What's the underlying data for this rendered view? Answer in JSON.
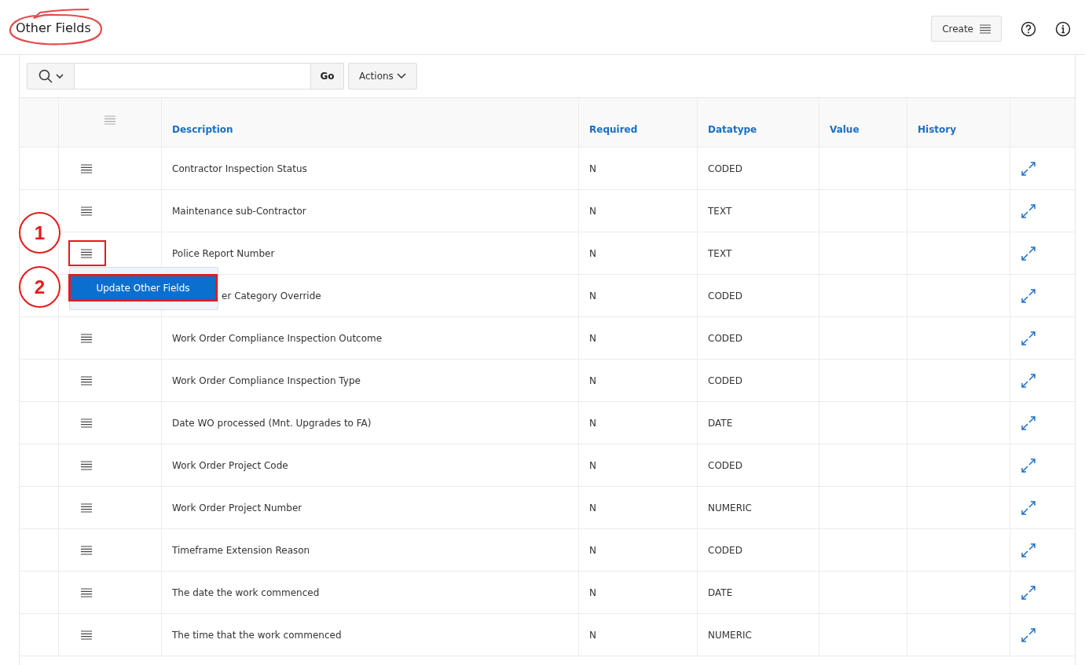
{
  "page": {
    "title": "Other Fields"
  },
  "header_actions": {
    "create_button": "Create"
  },
  "toolbar": {
    "go_button": "Go",
    "actions_button": "Actions"
  },
  "table": {
    "columns": [
      "Description",
      "Required",
      "Datatype",
      "Value",
      "History"
    ],
    "rows": [
      {
        "description": "Contractor Inspection Status",
        "required": "N",
        "datatype": "CODED"
      },
      {
        "description": "Maintenance sub-Contractor",
        "required": "N",
        "datatype": "TEXT"
      },
      {
        "description": "Police Report Number",
        "required": "N",
        "datatype": "TEXT"
      },
      {
        "description": "er Category Override",
        "required": "N",
        "datatype": "CODED",
        "partly_covered": true
      },
      {
        "description": "Work Order Compliance Inspection Outcome",
        "required": "N",
        "datatype": "CODED"
      },
      {
        "description": "Work Order Compliance Inspection Type",
        "required": "N",
        "datatype": "CODED"
      },
      {
        "description": "Date WO processed (Mnt. Upgrades to FA)",
        "required": "N",
        "datatype": "DATE"
      },
      {
        "description": "Work Order Project Code",
        "required": "N",
        "datatype": "CODED"
      },
      {
        "description": "Work Order Project Number",
        "required": "N",
        "datatype": "NUMERIC"
      },
      {
        "description": "Timeframe Extension Reason",
        "required": "N",
        "datatype": "CODED"
      },
      {
        "description": "The date the work commenced",
        "required": "N",
        "datatype": "DATE"
      },
      {
        "description": "The time that the work commenced",
        "required": "N",
        "datatype": "NUMERIC"
      }
    ]
  },
  "row_menu": {
    "items": [
      {
        "label": "Update Other Fields",
        "selected": true
      }
    ]
  },
  "callouts": [
    {
      "label": "1"
    },
    {
      "label": "2"
    }
  ]
}
